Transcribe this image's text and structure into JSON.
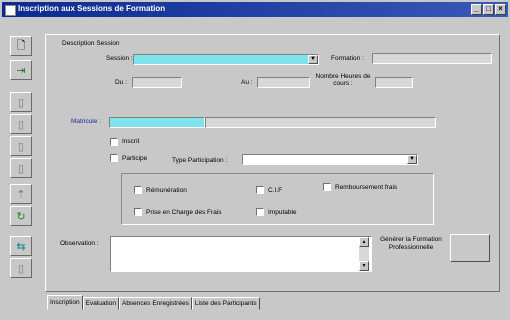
{
  "window": {
    "title": "Inscription aux Sessions de Formation",
    "controls": [
      "_",
      "□",
      "×"
    ]
  },
  "toolbar": {
    "buttons": [
      {
        "name": "new-doc-icon",
        "glyph": "🗋",
        "active": true
      },
      {
        "name": "enter-icon",
        "glyph": "⇥",
        "active": true
      },
      {
        "name": "disabled-1-icon",
        "glyph": "▯",
        "active": false
      },
      {
        "name": "disabled-2-icon",
        "glyph": "▯",
        "active": false
      },
      {
        "name": "disabled-3-icon",
        "glyph": "▯",
        "active": false
      },
      {
        "name": "disabled-4-icon",
        "glyph": "▯",
        "active": false
      },
      {
        "name": "disabled-5-icon",
        "glyph": "⇡",
        "active": false
      },
      {
        "name": "refresh-icon",
        "glyph": "↻",
        "active": true
      },
      {
        "name": "exit-icon",
        "glyph": "⇆",
        "active": true
      },
      {
        "name": "disabled-6-icon",
        "glyph": "▯",
        "active": false
      }
    ]
  },
  "session_group": {
    "title": "Description Session",
    "session_label": "Session :",
    "formation_label": "Formation :",
    "du_label": "Du :",
    "au_label": "Au :",
    "hours_label": "Nombre Heures de cours :"
  },
  "matricule_label": "Matricule :",
  "status": {
    "inscrit_label": "Inscrit",
    "participe_label": "Participe",
    "type_participation_label": "Type Participation :"
  },
  "options": {
    "remuneration_label": "Rémunération",
    "civ_label": "C.I.F",
    "remboursement_label": "Remboursement frais",
    "prise_en_charge_label": "Prise en Charge des Frais",
    "imputable_label": "Imputable"
  },
  "observation_label": "Observation :",
  "generate_label": "Générer la Formation Professionnelle",
  "tabs": [
    "Inscription",
    "Evaluation",
    "Absences Enregistrées",
    "Liste des Participants"
  ],
  "colors": {
    "highlight_field": "#7fe3ec",
    "titlebar": "#0b2a8f"
  }
}
